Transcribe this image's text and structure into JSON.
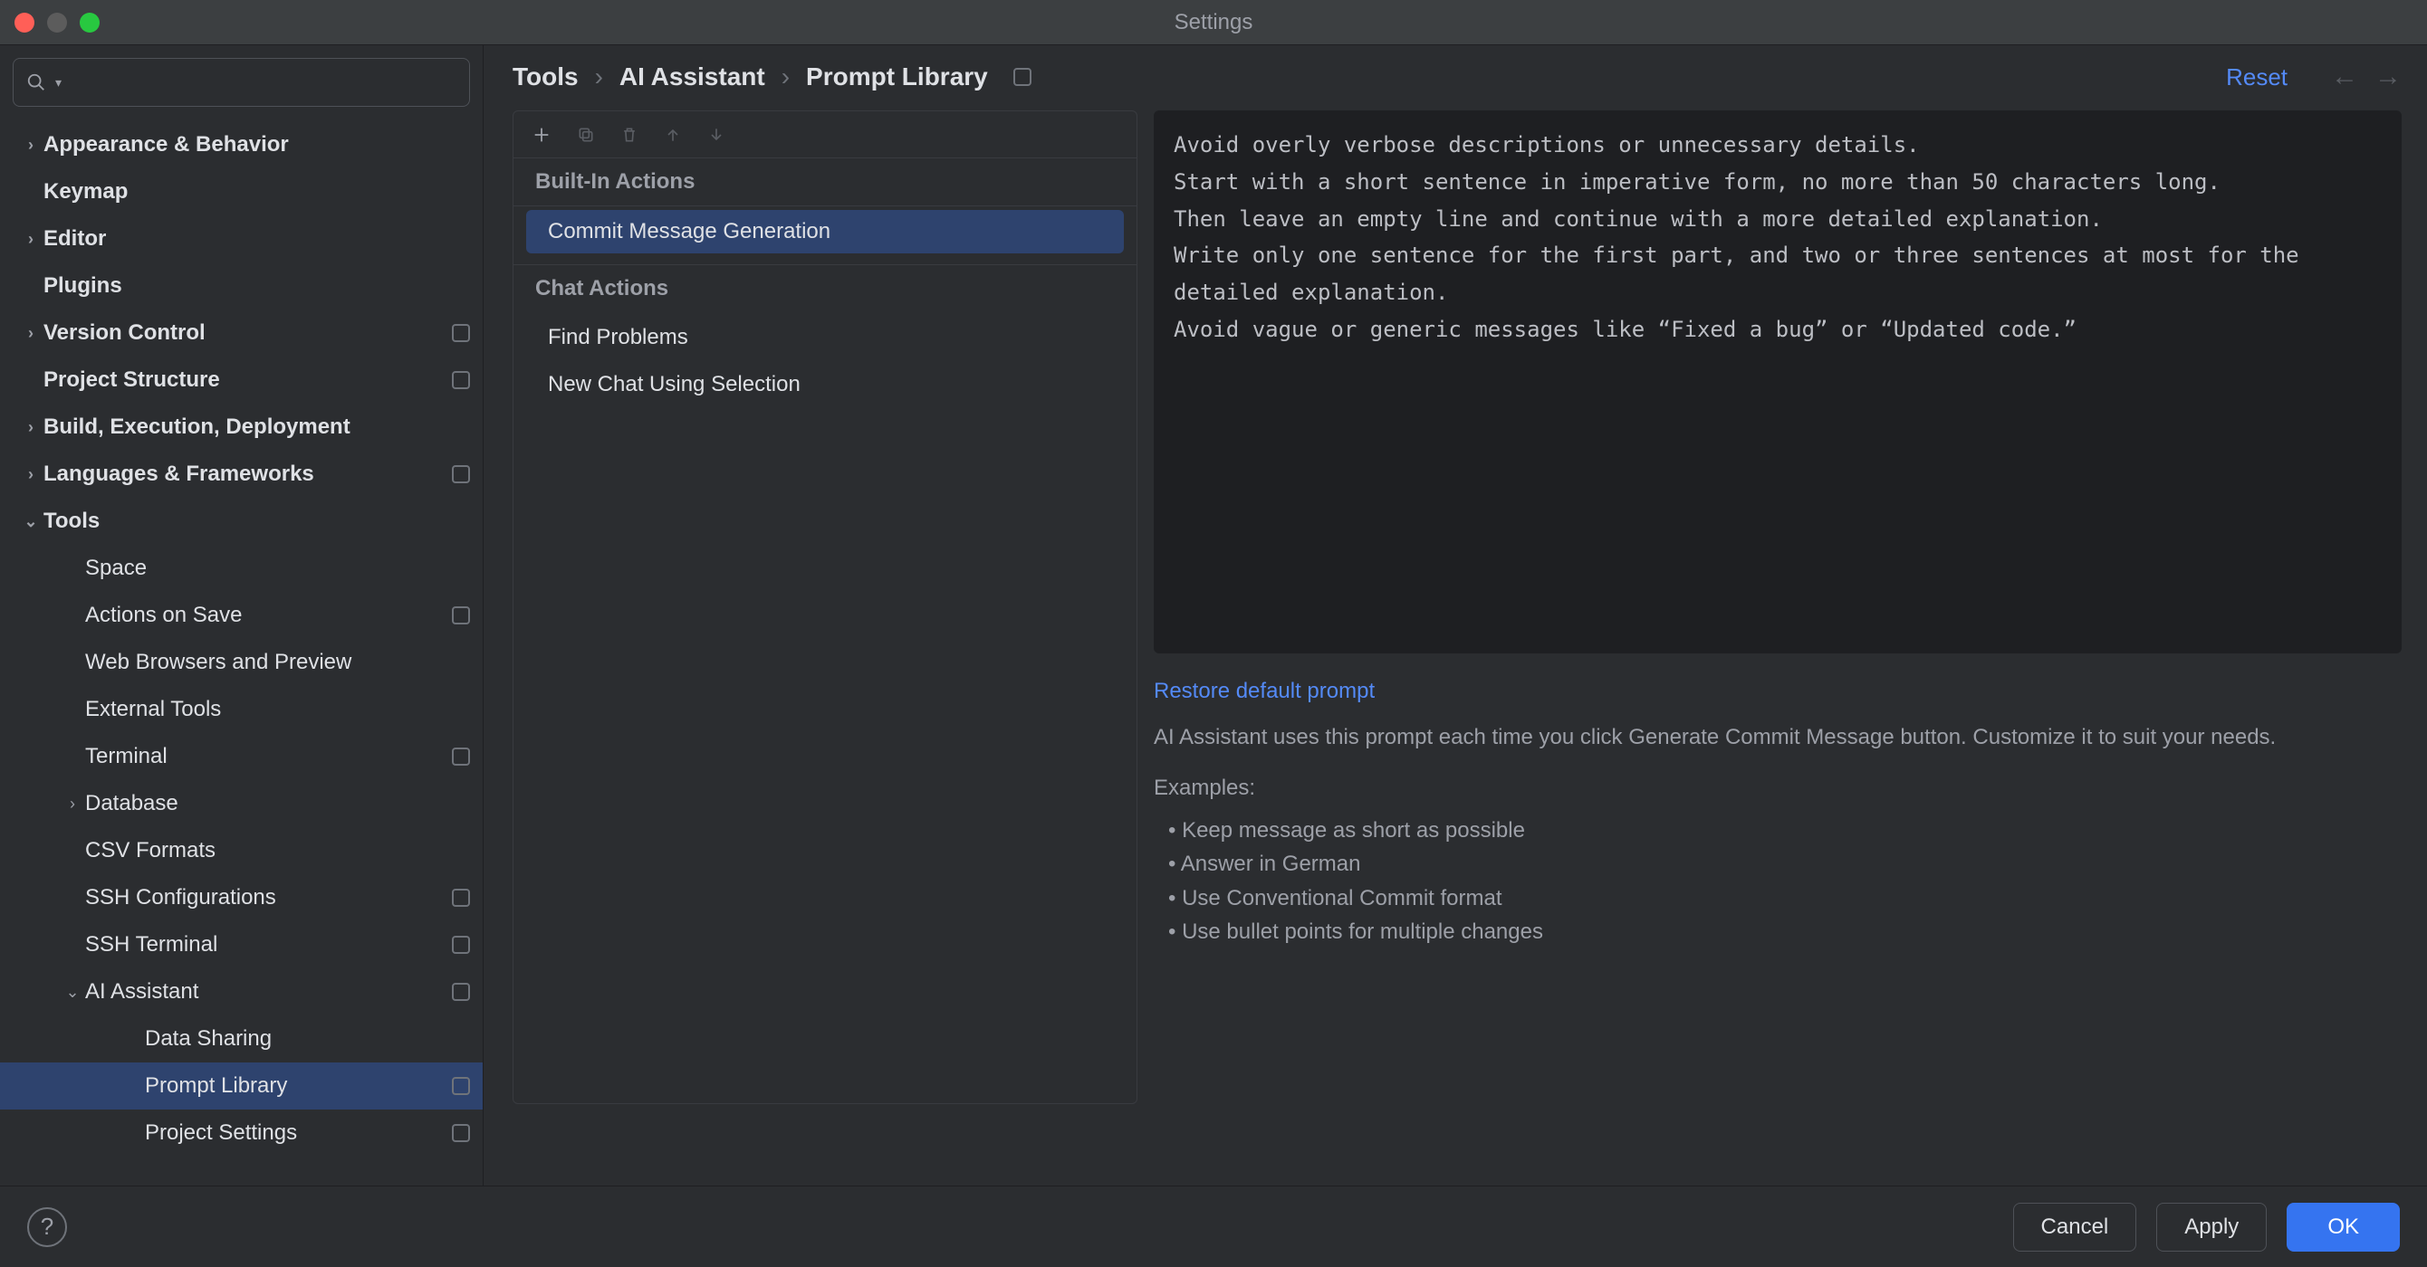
{
  "window": {
    "title": "Settings"
  },
  "search": {
    "placeholder": ""
  },
  "sidebar": {
    "items": [
      {
        "label": "Appearance & Behavior",
        "arrow": "›",
        "badge": false,
        "level": 0
      },
      {
        "label": "Keymap",
        "arrow": "",
        "badge": false,
        "level": 0
      },
      {
        "label": "Editor",
        "arrow": "›",
        "badge": false,
        "level": 0
      },
      {
        "label": "Plugins",
        "arrow": "",
        "badge": false,
        "level": 0
      },
      {
        "label": "Version Control",
        "arrow": "›",
        "badge": true,
        "level": 0
      },
      {
        "label": "Project Structure",
        "arrow": "",
        "badge": true,
        "level": 0
      },
      {
        "label": "Build, Execution, Deployment",
        "arrow": "›",
        "badge": false,
        "level": 0
      },
      {
        "label": "Languages & Frameworks",
        "arrow": "›",
        "badge": true,
        "level": 0
      },
      {
        "label": "Tools",
        "arrow": "⌄",
        "badge": false,
        "level": 0
      },
      {
        "label": "Space",
        "arrow": "",
        "badge": false,
        "level": 1
      },
      {
        "label": "Actions on Save",
        "arrow": "",
        "badge": true,
        "level": 1
      },
      {
        "label": "Web Browsers and Preview",
        "arrow": "",
        "badge": false,
        "level": 1
      },
      {
        "label": "External Tools",
        "arrow": "",
        "badge": false,
        "level": 1
      },
      {
        "label": "Terminal",
        "arrow": "",
        "badge": true,
        "level": 1
      },
      {
        "label": "Database",
        "arrow": "›",
        "badge": false,
        "level": 1
      },
      {
        "label": "CSV Formats",
        "arrow": "",
        "badge": false,
        "level": 1
      },
      {
        "label": "SSH Configurations",
        "arrow": "",
        "badge": true,
        "level": 1
      },
      {
        "label": "SSH Terminal",
        "arrow": "",
        "badge": true,
        "level": 1
      },
      {
        "label": "AI Assistant",
        "arrow": "⌄",
        "badge": true,
        "level": 1
      },
      {
        "label": "Data Sharing",
        "arrow": "",
        "badge": false,
        "level": 2
      },
      {
        "label": "Prompt Library",
        "arrow": "",
        "badge": true,
        "level": 2,
        "selected": true
      },
      {
        "label": "Project Settings",
        "arrow": "",
        "badge": true,
        "level": 2
      }
    ]
  },
  "breadcrumb": {
    "c1": "Tools",
    "c2": "AI Assistant",
    "c3": "Prompt Library",
    "reset": "Reset"
  },
  "actions": {
    "group1_title": "Built-In Actions",
    "group1_items": [
      "Commit Message Generation"
    ],
    "group2_title": "Chat Actions",
    "group2_items": [
      "Find Problems",
      "New Chat Using Selection"
    ]
  },
  "detail": {
    "prompt": "Avoid overly verbose descriptions or unnecessary details.\nStart with a short sentence in imperative form, no more than 50 characters long.\nThen leave an empty line and continue with a more detailed explanation.\nWrite only one sentence for the first part, and two or three sentences at most for the detailed explanation.\nAvoid vague or generic messages like “Fixed a bug” or “Updated code.”",
    "restore": "Restore default prompt",
    "help": "AI Assistant uses this prompt each time you click Generate Commit Message button. Customize it to suit your needs.",
    "examples_hd": "Examples:",
    "examples": [
      "Keep message as short as possible",
      "Answer in German",
      "Use Conventional Commit format",
      "Use bullet points for multiple changes"
    ]
  },
  "footer": {
    "cancel": "Cancel",
    "apply": "Apply",
    "ok": "OK"
  }
}
